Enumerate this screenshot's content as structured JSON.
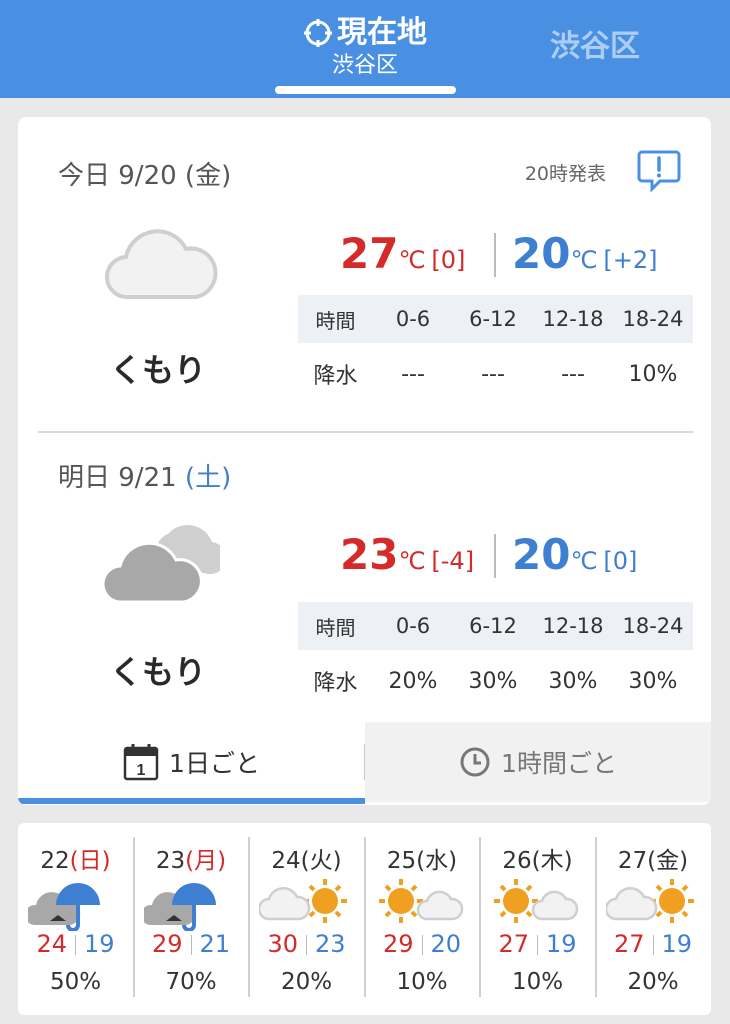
{
  "header": {
    "current_title": "現在地",
    "current_sub": "渋谷区",
    "other_tab": "渋谷区"
  },
  "today": {
    "date_prefix": "今日 9/20 (",
    "dow": "金",
    "date_suffix": ")",
    "issued": "20時発表",
    "weather": "くもり",
    "high": "27",
    "high_diff": "[0]",
    "low": "20",
    "low_diff": "[+2]",
    "unit": "℃",
    "time_label": "時間",
    "rain_label": "降水",
    "periods": [
      "0-6",
      "6-12",
      "12-18",
      "18-24"
    ],
    "rain": [
      "---",
      "---",
      "---",
      "10%"
    ]
  },
  "tomorrow": {
    "date_prefix": "明日 9/21 ",
    "dow": "(土)",
    "weather": "くもり",
    "high": "23",
    "high_diff": "[-4]",
    "low": "20",
    "low_diff": "[0]",
    "unit": "℃",
    "time_label": "時間",
    "rain_label": "降水",
    "periods": [
      "0-6",
      "6-12",
      "12-18",
      "18-24"
    ],
    "rain": [
      "20%",
      "30%",
      "30%",
      "30%"
    ]
  },
  "modes": {
    "daily": "1日ごと",
    "daily_calendar_number": "1",
    "hourly": "1時間ごと"
  },
  "weekly": [
    {
      "day": "22",
      "dow": "(日)",
      "dow_red": true,
      "icon": "cloud-umbrella-icon",
      "high": "24",
      "low": "19",
      "rain": "50%"
    },
    {
      "day": "23",
      "dow": "(月)",
      "dow_red": true,
      "icon": "cloud-umbrella-icon",
      "high": "29",
      "low": "21",
      "rain": "70%"
    },
    {
      "day": "24",
      "dow": "(火)",
      "dow_red": false,
      "icon": "cloud-sun-icon",
      "high": "30",
      "low": "23",
      "rain": "20%"
    },
    {
      "day": "25",
      "dow": "(水)",
      "dow_red": false,
      "icon": "sun-cloud-icon",
      "high": "29",
      "low": "20",
      "rain": "10%"
    },
    {
      "day": "26",
      "dow": "(木)",
      "dow_red": false,
      "icon": "sun-cloud-icon",
      "high": "27",
      "low": "19",
      "rain": "10%"
    },
    {
      "day": "27",
      "dow": "(金)",
      "dow_red": false,
      "icon": "cloud-sun-icon",
      "high": "27",
      "low": "19",
      "rain": "20%"
    }
  ],
  "colors": {
    "header_bg": "#4a90e2",
    "high_temp": "#d42a2a",
    "low_temp": "#3f7fd1"
  }
}
